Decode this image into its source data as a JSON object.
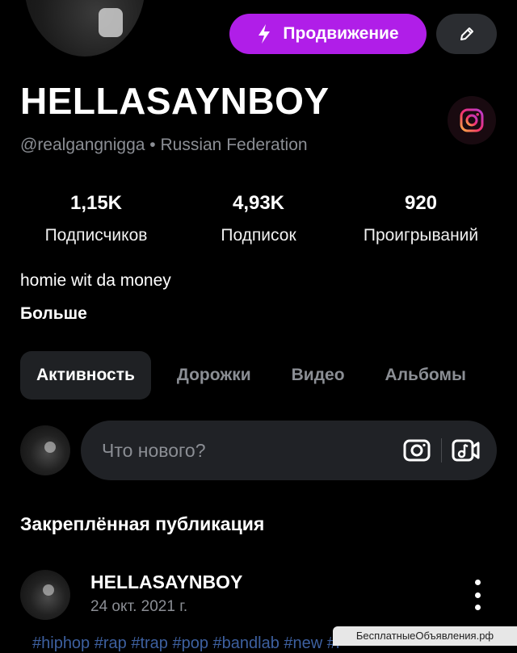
{
  "header": {
    "promote_label": "Продвижение",
    "edit_icon": "pencil-icon",
    "promote_color": "#b01ee8"
  },
  "profile": {
    "name": "HELLASAYNBOY",
    "handle": "@realgangnigga",
    "separator": "•",
    "country": "Russian Federation",
    "instagram_icon": "instagram-icon",
    "bio": "homie wit da money",
    "more_label": "Больше"
  },
  "stats": [
    {
      "value": "1,15K",
      "label": "Подписчиков"
    },
    {
      "value": "4,93K",
      "label": "Подписок"
    },
    {
      "value": "920",
      "label": "Проигрываний"
    }
  ],
  "tabs": [
    {
      "label": "Активность",
      "active": true
    },
    {
      "label": "Дорожки",
      "active": false
    },
    {
      "label": "Видео",
      "active": false
    },
    {
      "label": "Альбомы",
      "active": false
    }
  ],
  "composer": {
    "placeholder": "Что нового?",
    "photo_icon": "camera-icon",
    "clip_icon": "video-clip-icon"
  },
  "pinned": {
    "heading": "Закреплённая публикация",
    "author": "HELLASAYNBOY",
    "date": "24 окт. 2021 г.",
    "menu_icon": "more-vertical-icon",
    "tags_partial": "#hiphop #rap #trap #pop #bandlab #new #r"
  },
  "watermark": "БесплатныеОбъявления.рф"
}
